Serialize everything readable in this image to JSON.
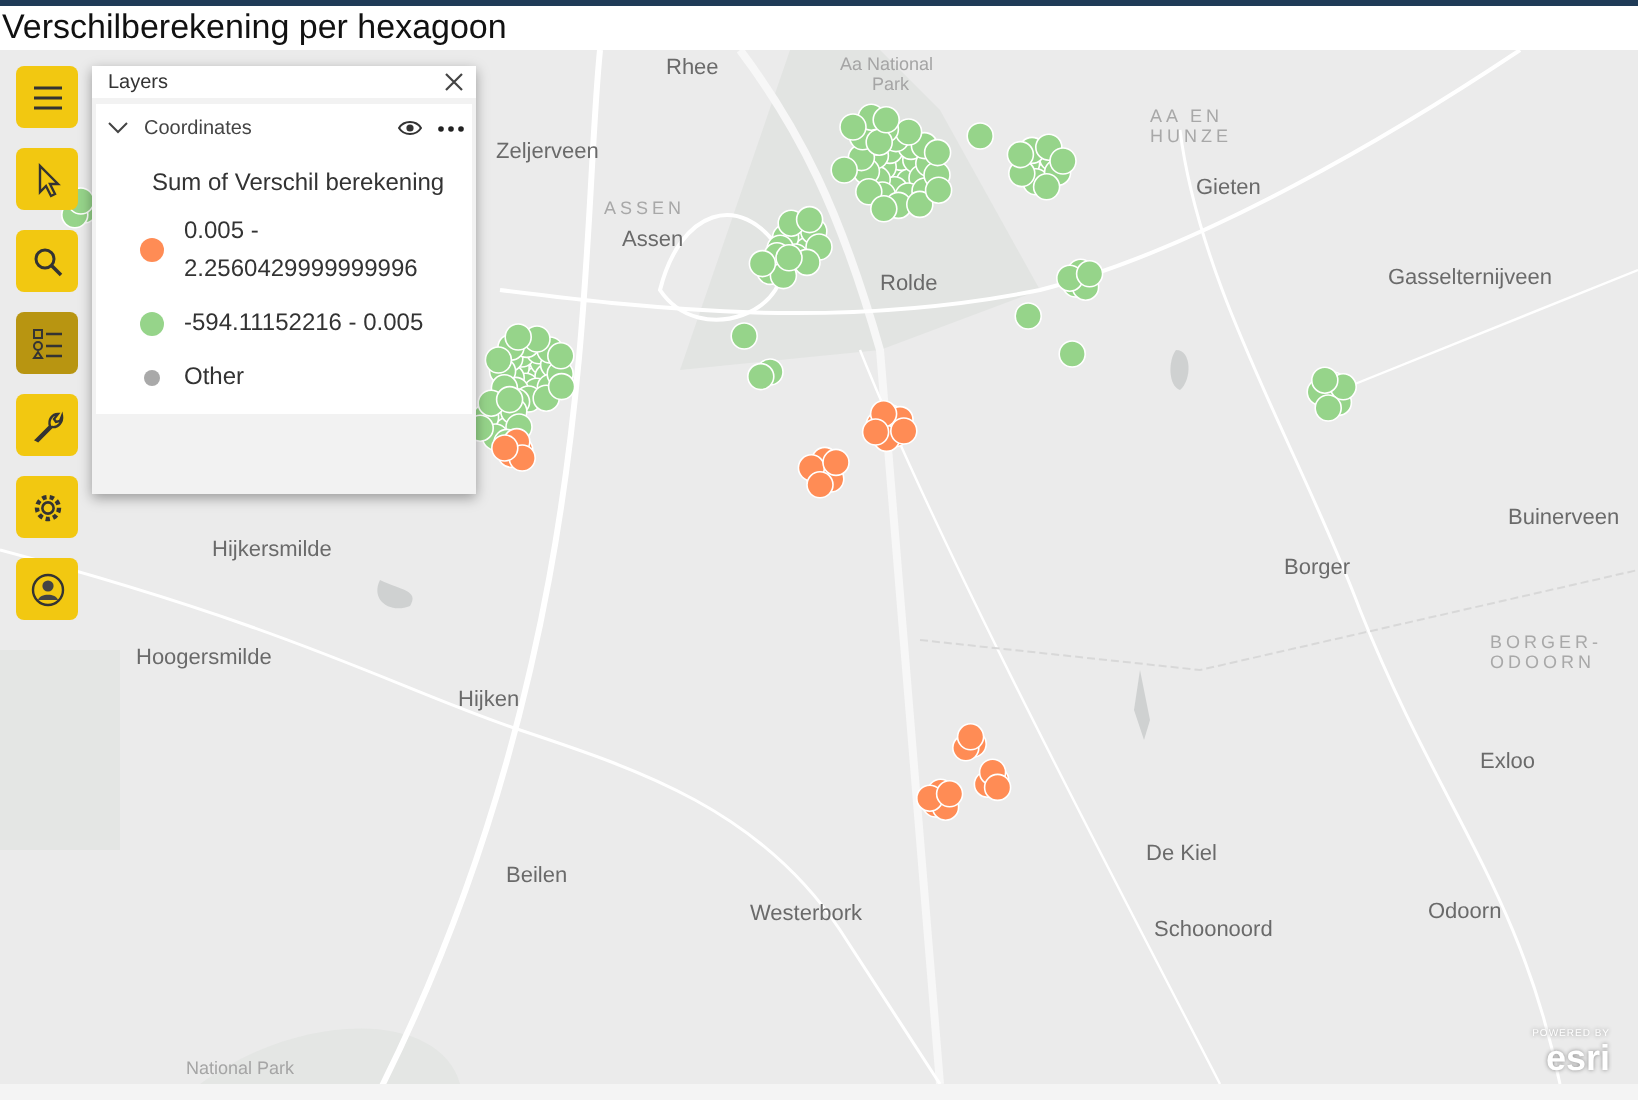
{
  "title": "Verschilberekening per hexagoon",
  "toolbar": [
    {
      "selected": false
    },
    {
      "selected": false
    },
    {
      "selected": false
    },
    {
      "selected": true
    },
    {
      "selected": false
    },
    {
      "selected": false
    },
    {
      "selected": false
    }
  ],
  "layers_panel": {
    "title": "Layers",
    "layer": {
      "name": "Coordinates",
      "expanded": true
    },
    "legend_title": "Sum of Verschil berekening",
    "legend": [
      {
        "label": "0.005 - 2.2560429999999996",
        "color": "#ff8c55",
        "kind": "range"
      },
      {
        "label": "-594.11152216 - 0.005",
        "color": "#96d48a",
        "kind": "range"
      },
      {
        "label": "Other",
        "color": "#a9a9a9",
        "kind": "other"
      }
    ]
  },
  "map": {
    "labels": [
      {
        "text": "Rhee",
        "kind": "town"
      },
      {
        "text": "Aa National",
        "kind": "park"
      },
      {
        "text": "Park",
        "kind": "park"
      },
      {
        "text": "Zeljerveen",
        "kind": "town"
      },
      {
        "text": "ASSEN",
        "kind": "region"
      },
      {
        "text": "Assen",
        "kind": "town"
      },
      {
        "text": "Rolde",
        "kind": "town"
      },
      {
        "text": "AA EN",
        "kind": "region"
      },
      {
        "text": "HUNZE",
        "kind": "region"
      },
      {
        "text": "Gieten",
        "kind": "town"
      },
      {
        "text": "Gasselternijveen",
        "kind": "town"
      },
      {
        "text": "Hijkersmilde",
        "kind": "town"
      },
      {
        "text": "Buinerveen",
        "kind": "town"
      },
      {
        "text": "Borger",
        "kind": "town"
      },
      {
        "text": "BORGER-",
        "kind": "region"
      },
      {
        "text": "ODOORN",
        "kind": "region"
      },
      {
        "text": "Hoogersmilde",
        "kind": "town"
      },
      {
        "text": "Hijken",
        "kind": "town"
      },
      {
        "text": "Exloo",
        "kind": "town"
      },
      {
        "text": "De Kiel",
        "kind": "town"
      },
      {
        "text": "Beilen",
        "kind": "town"
      },
      {
        "text": "Westerbork",
        "kind": "town"
      },
      {
        "text": "Odoorn",
        "kind": "town"
      },
      {
        "text": "Schoonoord",
        "kind": "town"
      },
      {
        "text": "National Park",
        "kind": "park"
      }
    ],
    "attribution": {
      "powered": "POWERED BY",
      "brand": "esri"
    }
  }
}
